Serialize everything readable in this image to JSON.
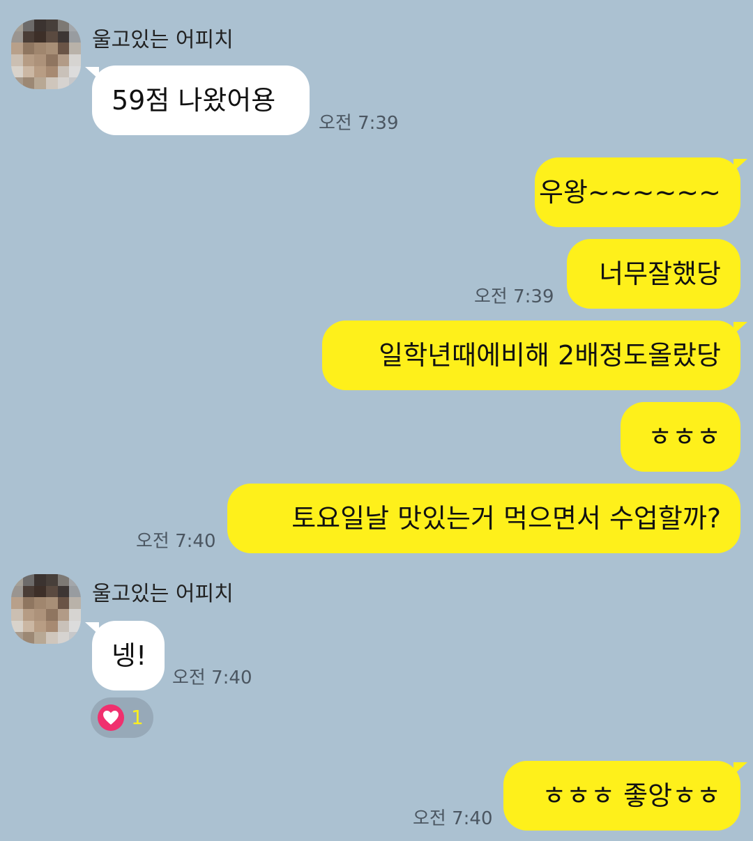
{
  "chat": {
    "messages": [
      {
        "sender": "울고있는 어피치",
        "text": "59점 나왔어용",
        "time": "오전 7:39"
      },
      {
        "text": "우왕~~~~~~"
      },
      {
        "text": "너무잘했당",
        "time": "오전 7:39"
      },
      {
        "text": "일학년때에비해 2배정도올랐당"
      },
      {
        "text": "ㅎㅎㅎ"
      },
      {
        "text": "토요일날 맛있는거 먹으면서 수업할까?",
        "time": "오전 7:40"
      },
      {
        "sender": "울고있는 어피치",
        "text": "넹!",
        "time": "오전 7:40",
        "reaction": {
          "icon": "heart-icon",
          "count": "1"
        }
      },
      {
        "text": "ㅎㅎㅎ 좋앙ㅎㅎ",
        "time": "오전 7:40"
      }
    ]
  },
  "colors": {
    "background": "#abc1d1",
    "outgoing_bubble": "#fef01b",
    "incoming_bubble": "#ffffff",
    "reaction_heart": "#f0306e"
  }
}
